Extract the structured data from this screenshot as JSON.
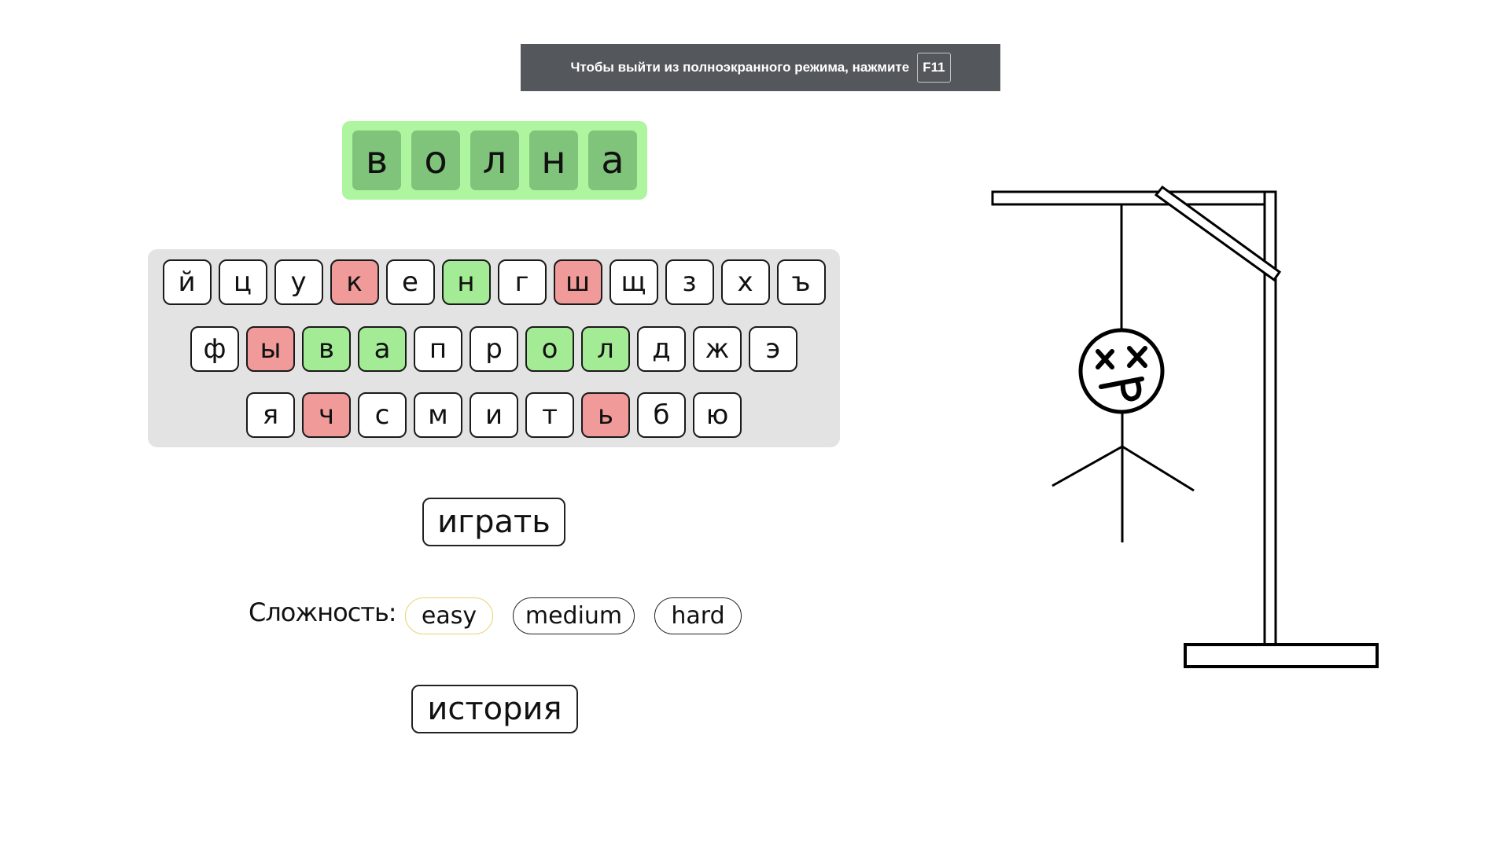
{
  "fullscreen_notice": {
    "text": "Чтобы выйти из полноэкранного режима, нажмите",
    "key": "F11"
  },
  "word": {
    "letters": [
      "в",
      "о",
      "л",
      "н",
      "а"
    ]
  },
  "keyboard": {
    "rows": [
      [
        {
          "letter": "й",
          "state": "unused"
        },
        {
          "letter": "ц",
          "state": "unused"
        },
        {
          "letter": "у",
          "state": "unused"
        },
        {
          "letter": "к",
          "state": "wrong"
        },
        {
          "letter": "е",
          "state": "unused"
        },
        {
          "letter": "н",
          "state": "correct"
        },
        {
          "letter": "г",
          "state": "unused"
        },
        {
          "letter": "ш",
          "state": "wrong"
        },
        {
          "letter": "щ",
          "state": "unused"
        },
        {
          "letter": "з",
          "state": "unused"
        },
        {
          "letter": "х",
          "state": "unused"
        },
        {
          "letter": "ъ",
          "state": "unused"
        }
      ],
      [
        {
          "letter": "ф",
          "state": "unused"
        },
        {
          "letter": "ы",
          "state": "wrong"
        },
        {
          "letter": "в",
          "state": "correct"
        },
        {
          "letter": "а",
          "state": "correct"
        },
        {
          "letter": "п",
          "state": "unused"
        },
        {
          "letter": "р",
          "state": "unused"
        },
        {
          "letter": "о",
          "state": "correct"
        },
        {
          "letter": "л",
          "state": "correct"
        },
        {
          "letter": "д",
          "state": "unused"
        },
        {
          "letter": "ж",
          "state": "unused"
        },
        {
          "letter": "э",
          "state": "unused"
        }
      ],
      [
        {
          "letter": "я",
          "state": "unused"
        },
        {
          "letter": "ч",
          "state": "wrong"
        },
        {
          "letter": "с",
          "state": "unused"
        },
        {
          "letter": "м",
          "state": "unused"
        },
        {
          "letter": "и",
          "state": "unused"
        },
        {
          "letter": "т",
          "state": "unused"
        },
        {
          "letter": "ь",
          "state": "wrong"
        },
        {
          "letter": "б",
          "state": "unused"
        },
        {
          "letter": "ю",
          "state": "unused"
        }
      ]
    ]
  },
  "controls": {
    "play_label": "играть",
    "difficulty_label": "Сложность:",
    "difficulty_options": [
      "easy",
      "medium",
      "hard"
    ],
    "selected_difficulty": "easy",
    "history_label": "история"
  },
  "colors": {
    "word_panel_bg": "#aef5a0",
    "word_letter_bg": "#7fc47a",
    "key_wrong": "#f09a9a",
    "key_correct": "#a3eb95",
    "keyboard_bg": "#e3e3e3",
    "selected_pill_border": "#e8d36a",
    "banner_bg": "#54585c"
  },
  "hangman": {
    "state": "dead",
    "face": "dead-x-eyes-tongue-icon"
  }
}
